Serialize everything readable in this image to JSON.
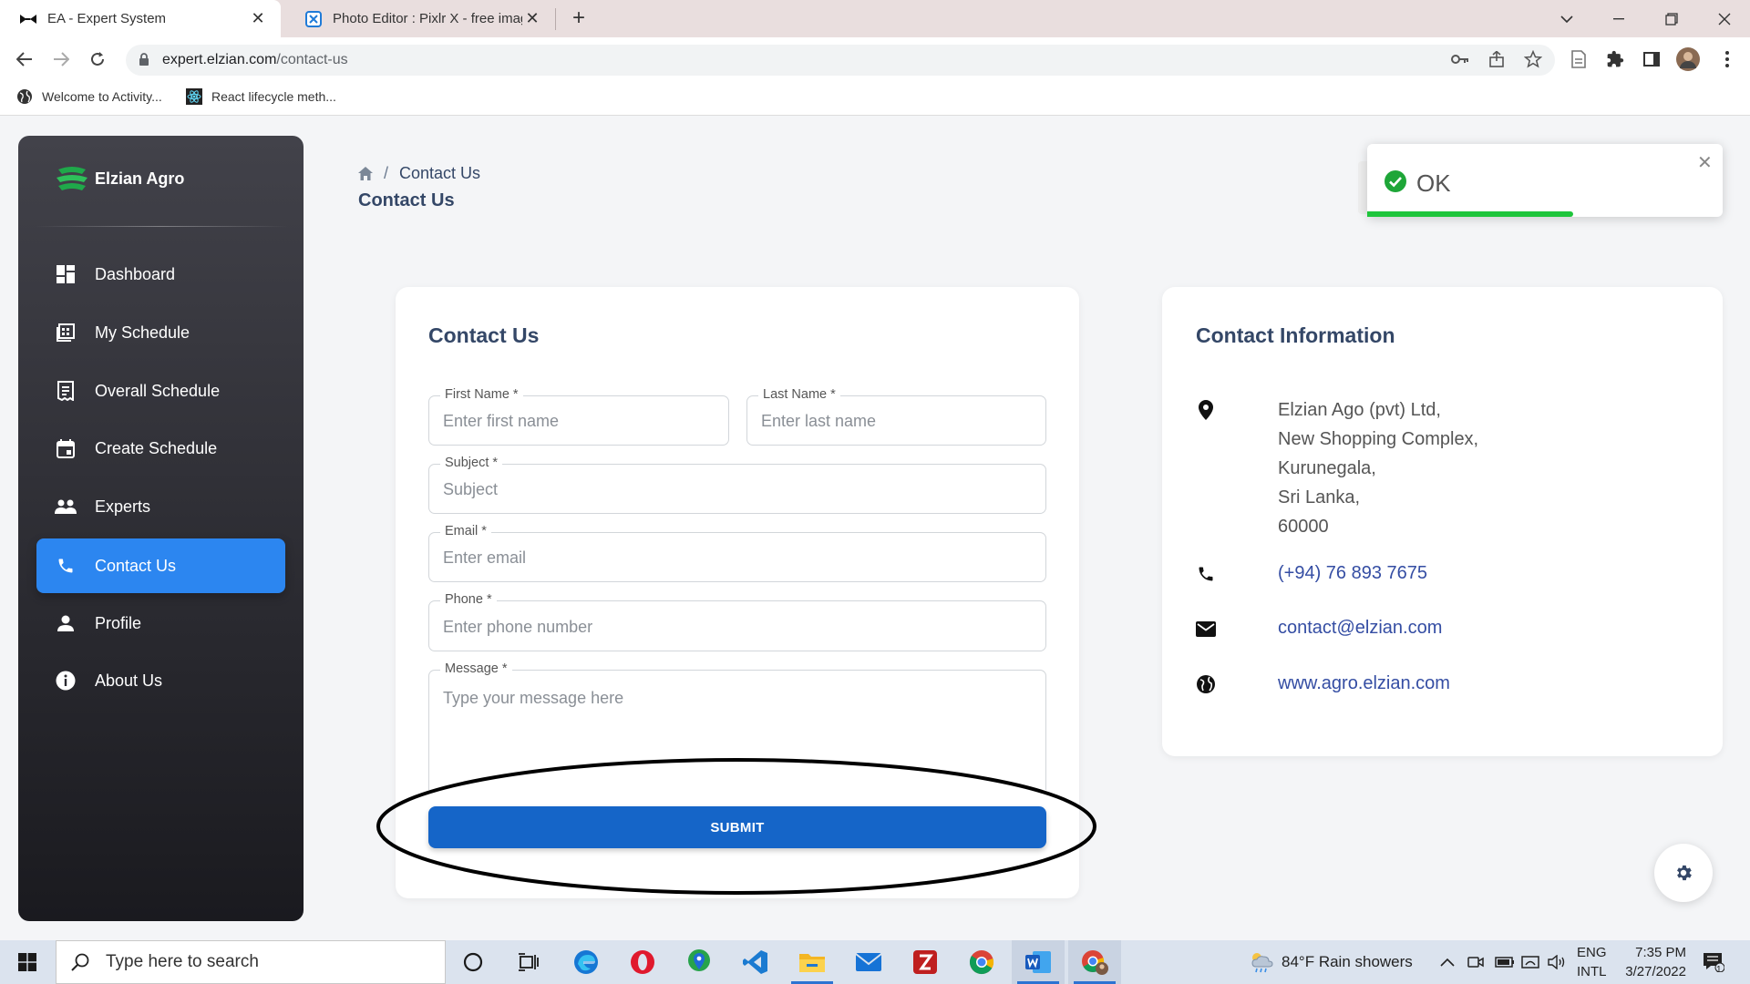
{
  "browser": {
    "tabs": [
      {
        "title": "EA - Expert System",
        "active": true
      },
      {
        "title": "Photo Editor : Pixlr X - free image",
        "active": false
      }
    ],
    "url_host": "expert.elzian.com",
    "url_path": "/contact-us",
    "bookmarks": [
      "Welcome to Activity...",
      "React lifecycle meth..."
    ]
  },
  "sidebar": {
    "brand": "Elzian Agro",
    "items": [
      {
        "label": "Dashboard",
        "icon": "dashboard-icon"
      },
      {
        "label": "My Schedule",
        "icon": "schedule-icon"
      },
      {
        "label": "Overall Schedule",
        "icon": "receipt-icon"
      },
      {
        "label": "Create Schedule",
        "icon": "calendar-icon"
      },
      {
        "label": "Experts",
        "icon": "people-icon"
      },
      {
        "label": "Contact Us",
        "icon": "phone-icon",
        "active": true
      },
      {
        "label": "Profile",
        "icon": "person-icon"
      },
      {
        "label": "About Us",
        "icon": "info-icon"
      }
    ]
  },
  "breadcrumb": {
    "current": "Contact Us"
  },
  "page_title": "Contact Us",
  "toast": {
    "message": "OK",
    "progress": 0.58,
    "color": "#1ec53b"
  },
  "form": {
    "title": "Contact Us",
    "first_name": {
      "label": "First Name *",
      "placeholder": "Enter first name"
    },
    "last_name": {
      "label": "Last Name *",
      "placeholder": "Enter last name"
    },
    "subject": {
      "label": "Subject *",
      "placeholder": "Subject"
    },
    "email": {
      "label": "Email *",
      "placeholder": "Enter email"
    },
    "phone": {
      "label": "Phone *",
      "placeholder": "Enter phone number"
    },
    "message": {
      "label": "Message *",
      "placeholder": "Type your message here"
    },
    "submit": "SUBMIT"
  },
  "contact_info": {
    "title": "Contact Information",
    "address": [
      "Elzian Ago (pvt) Ltd,",
      "New Shopping Complex,",
      "Kurunegala,",
      "Sri Lanka,",
      "60000"
    ],
    "phone": "(+94) 76 893 7675",
    "email": "contact@elzian.com",
    "website": "www.agro.elzian.com"
  },
  "taskbar": {
    "search_placeholder": "Type here to search",
    "weather": "84°F  Rain showers",
    "lang_line1": "ENG",
    "lang_line2": "INTL",
    "time": "7:35 PM",
    "date": "3/27/2022",
    "notification_count": "1"
  },
  "colors": {
    "accent": "#2c86f0",
    "submit": "#1565c8",
    "heading": "#344767",
    "link": "#344da3"
  }
}
